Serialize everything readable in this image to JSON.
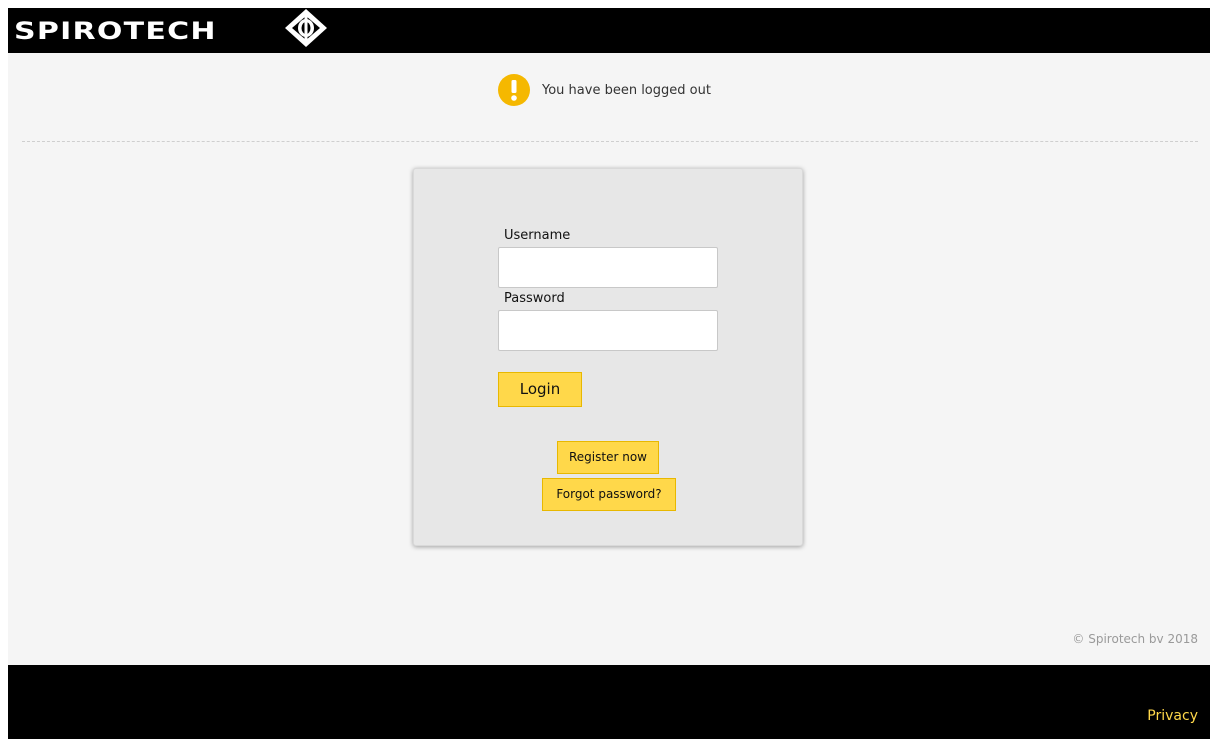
{
  "header": {
    "brand_text": "SPIROTECH",
    "logo_icon": "spirotech-diamond-logo-icon"
  },
  "alert": {
    "icon": "warning-exclamation-icon",
    "message": "You have been logged out",
    "icon_color": "#f5b800"
  },
  "login_form": {
    "username_label": "Username",
    "username_value": "",
    "username_placeholder": "",
    "password_label": "Password",
    "password_value": "",
    "password_placeholder": "",
    "login_label": "Login",
    "register_label": "Register now",
    "forgot_label": "Forgot password?"
  },
  "footer": {
    "copyright": "© Spirotech bv 2018",
    "privacy_label": "Privacy"
  },
  "colors": {
    "accent": "#ffd84a",
    "header_bg": "#000000",
    "page_bg": "#f5f5f5",
    "form_bg": "#e7e7e7"
  }
}
